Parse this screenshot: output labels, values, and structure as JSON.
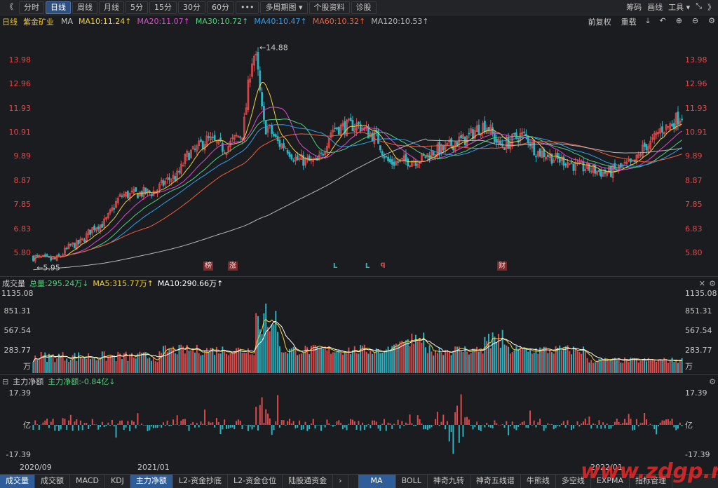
{
  "toolbar": {
    "back": "《",
    "tabs": [
      "分时",
      "日线",
      "周线",
      "月线",
      "5分",
      "15分",
      "30分",
      "60分",
      "•••",
      "多周期图 ▾",
      "个股资料",
      "诊股"
    ],
    "active_tab": "日线",
    "right_items": [
      "筹码",
      "画线",
      "工具 ▾",
      "⤡",
      "》"
    ]
  },
  "legend": {
    "period": "日线",
    "stock": "紫金矿业",
    "ma_label": "MA",
    "ma10": "MA10:11.24↑",
    "ma20": "MA20:11.07↑",
    "ma30": "MA30:10.72↑",
    "ma40": "MA40:10.47↑",
    "ma60": "MA60:10.32↑",
    "ma120": "MA120:10.53↑",
    "restore": "前复权",
    "reload": "重载"
  },
  "colors": {
    "up": "#e04a4a",
    "down": "#2bb3c0",
    "ma10": "#f0d23c",
    "ma20": "#e047d2",
    "ma30": "#4fd07a",
    "ma40": "#2f9ff0",
    "ma60": "#f0603a",
    "ma120": "#b8b8b8"
  },
  "price_axis": {
    "ticks": [
      "13.98",
      "12.96",
      "11.93",
      "10.91",
      "9.89",
      "8.87",
      "7.85",
      "6.83",
      "5.80"
    ],
    "high_label": "14.88",
    "low_label": "5.95",
    "range": [
      5.45,
      15.3
    ]
  },
  "event_markers": [
    {
      "text": "榜",
      "kind": "box"
    },
    {
      "text": "涨",
      "kind": "box"
    },
    {
      "text": "L",
      "kind": "cyan"
    },
    {
      "text": "L",
      "kind": "cyan"
    },
    {
      "text": "q",
      "kind": "red"
    },
    {
      "text": "财",
      "kind": "box"
    }
  ],
  "volume_legend": {
    "title": "成交量",
    "total": "总量:295.24万↓",
    "ma5": "MA5:315.77万↑",
    "ma10": "MA10:290.66万↑"
  },
  "volume_axis": {
    "ticks": [
      "1135.08",
      "851.31",
      "567.54",
      "283.77",
      "万"
    ]
  },
  "flow_legend": {
    "title": "主力净额",
    "value": "主力净额:-0.84亿↓"
  },
  "flow_axis": {
    "ticks": [
      "17.39",
      "亿",
      "-17.39"
    ]
  },
  "dates": [
    "2020/09",
    "2021/01",
    "2022/01"
  ],
  "bottom_tabs": [
    "成交量",
    "成交额",
    "MACD",
    "KDJ",
    "主力净额",
    "L2-资金抄底",
    "L2-资金仓位",
    "陆股通资金"
  ],
  "bottom_active": "主力净额",
  "bottom_tabs_right": [
    "MA",
    "BOLL",
    "神奇九转",
    "神奇五线谱",
    "牛熊线",
    "多空线",
    "EXPMA",
    "指标管理"
  ],
  "bottom_right_active": "MA",
  "watermark": "www.zdgp.net",
  "chart_data": {
    "type": "candlestick",
    "title": "紫金矿业 日线",
    "y_range": [
      5.45,
      15.3
    ],
    "candles_summary": {
      "count": 330,
      "start": "2020/09",
      "end": "2022/02",
      "high": 14.88,
      "low": 5.95,
      "last": 11.8
    }
  }
}
